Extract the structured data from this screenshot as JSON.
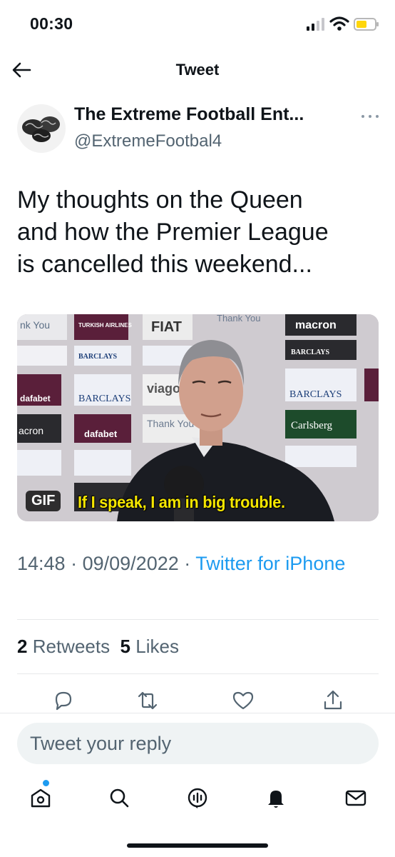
{
  "status_bar": {
    "time": "00:30"
  },
  "nav": {
    "title": "Tweet"
  },
  "author": {
    "name": "The Extreme Football Ent...",
    "handle": "@ExtremeFootbal4"
  },
  "tweet": {
    "text_lines": [
      "My thoughts on the Queen",
      "and how the Premier League",
      "is cancelled this weekend..."
    ],
    "media": {
      "badge": "GIF",
      "subtitle": "If I speak, I am in big trouble.",
      "backdrop_labels": [
        "nk You",
        "TURKISH AIRLINES",
        "FIAT",
        "Thank You",
        "macron",
        "BARCLAYS",
        "dafabet",
        "viago",
        "Carlsberg",
        "acron"
      ]
    }
  },
  "meta": {
    "time": "14:48",
    "date": "09/09/2022",
    "source": "Twitter for iPhone"
  },
  "stats": {
    "retweets_count": "2",
    "retweets_label": "Retweets",
    "likes_count": "5",
    "likes_label": "Likes"
  },
  "reply": {
    "placeholder": "Tweet your reply"
  },
  "colors": {
    "accent": "#1d9bf0",
    "text": "#0f1419",
    "secondary": "#536471"
  },
  "icons": {
    "actions": [
      "reply-icon",
      "retweet-icon",
      "like-icon",
      "share-icon"
    ],
    "tabs": [
      "home-icon",
      "search-icon",
      "spaces-icon",
      "notifications-icon",
      "messages-icon"
    ]
  }
}
